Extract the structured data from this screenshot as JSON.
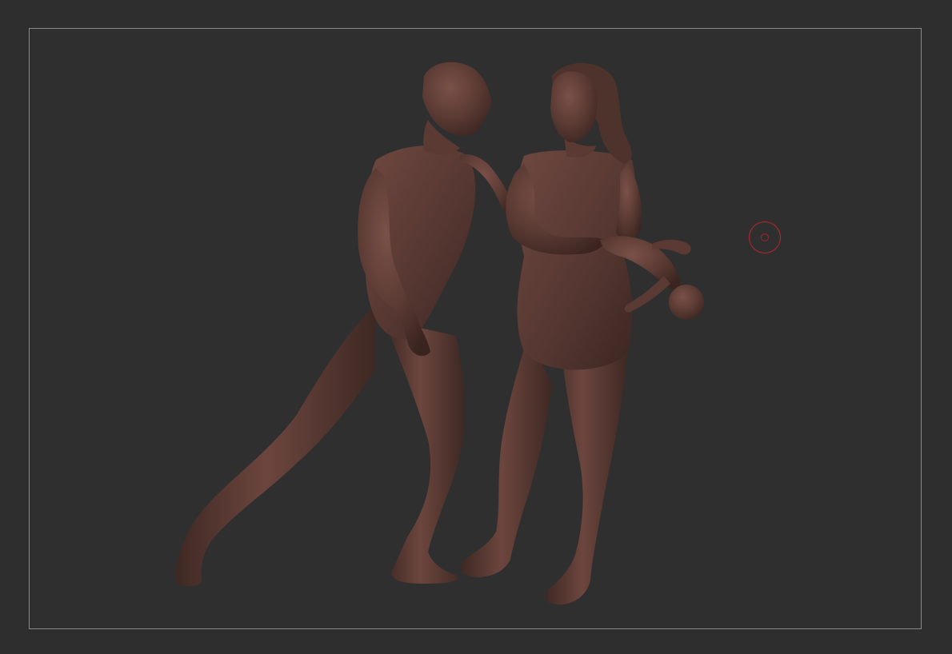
{
  "app": {
    "canvas_background": "#2e2e2e",
    "frame_color": "#8a8a8a",
    "model_color": "#5a3a33",
    "model_highlight": "#7a5148",
    "model_shadow": "#3a2420",
    "brush_cursor_color": "#b8262b"
  },
  "scene": {
    "figures": [
      {
        "name": "adult-male-figure"
      },
      {
        "name": "adult-female-figure"
      },
      {
        "name": "infant-figure"
      }
    ]
  }
}
